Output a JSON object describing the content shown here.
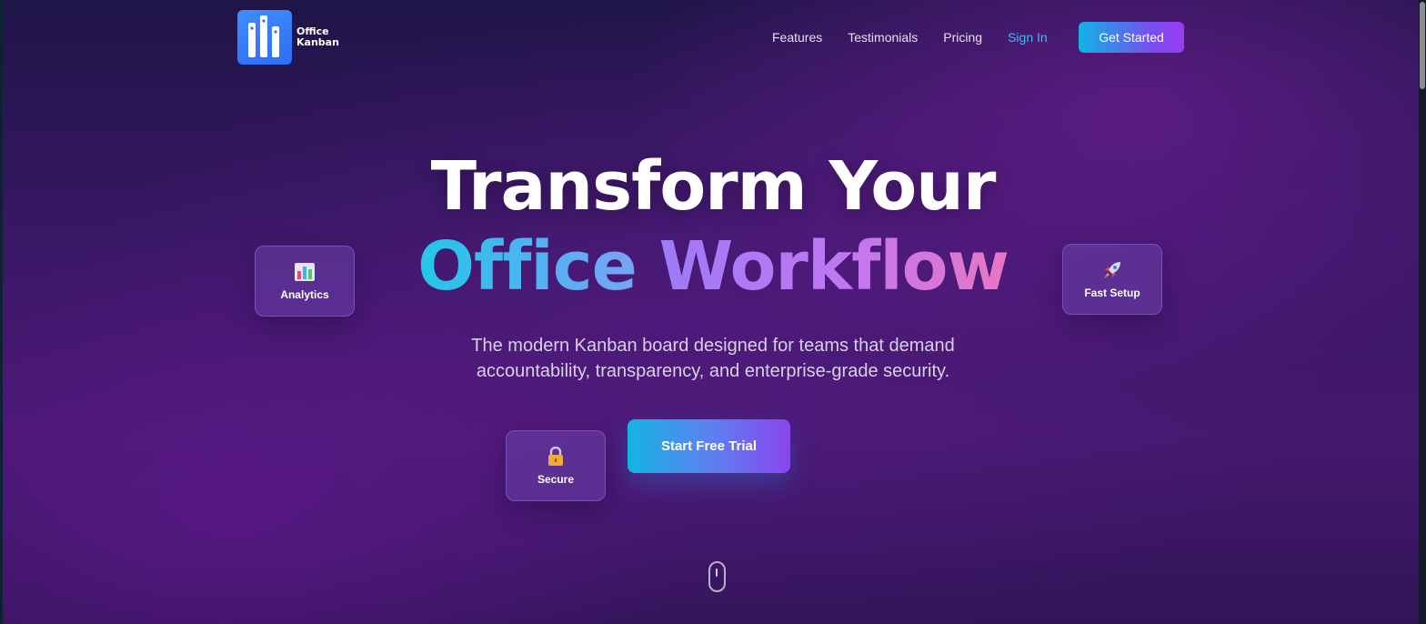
{
  "brand": {
    "line1": "Office",
    "line2": "Kanban",
    "logo_icon": "kanban-columns-icon",
    "logo_color": "#3b82f6"
  },
  "nav": {
    "links": [
      {
        "label": "Features"
      },
      {
        "label": "Testimonials"
      },
      {
        "label": "Pricing"
      },
      {
        "label": "Sign In"
      }
    ],
    "cta_label": "Get Started"
  },
  "hero": {
    "title_line1": "Transform Your",
    "title_word_a": "Office",
    "title_word_b": "Workflow",
    "subtitle_line1": "The modern Kanban board designed for teams that demand",
    "subtitle_line2": "accountability, transparency, and enterprise-grade security.",
    "cta_label": "Start Free Trial"
  },
  "floating_cards": [
    {
      "label": "Analytics",
      "icon": "bar-chart-icon"
    },
    {
      "label": "Fast Setup",
      "icon": "rocket-icon"
    },
    {
      "label": "Secure",
      "icon": "lock-icon"
    }
  ],
  "colors": {
    "accent_cyan": "#22c7e8",
    "accent_purple": "#8a45ee",
    "accent_pink": "#e777c0",
    "signin_link": "#38bdf8"
  }
}
